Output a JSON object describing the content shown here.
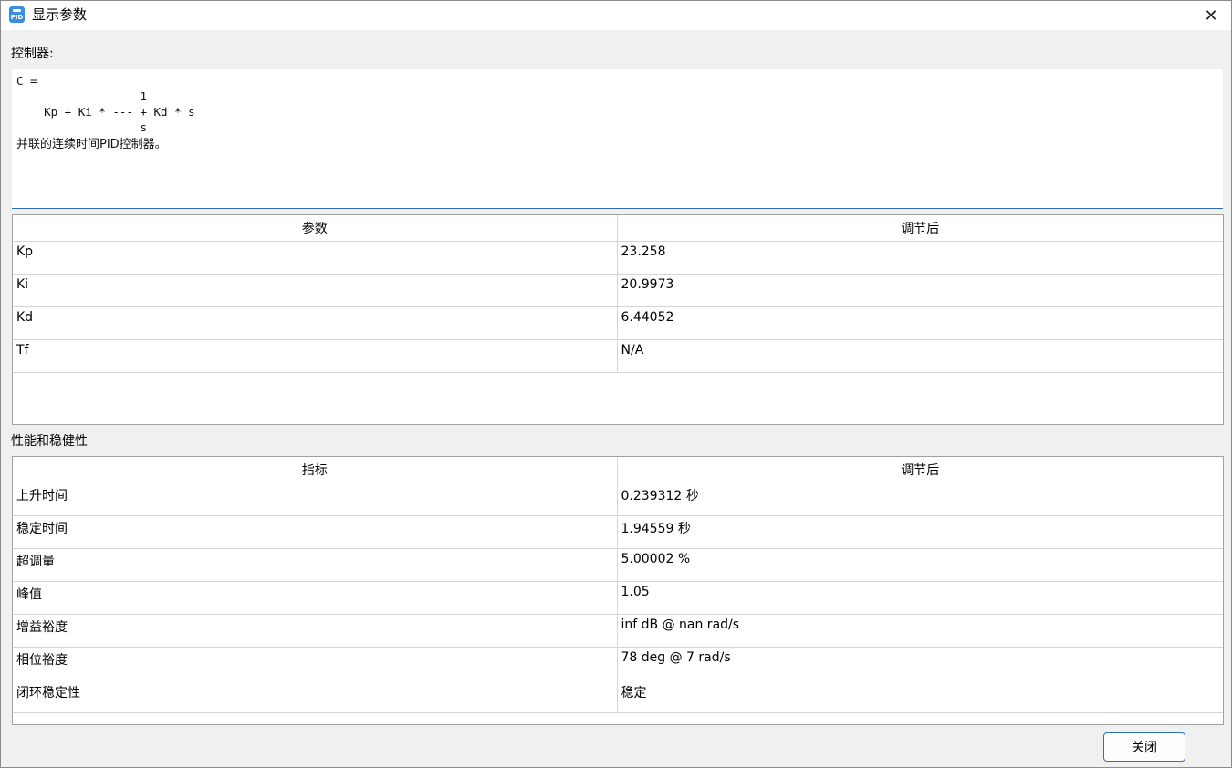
{
  "window": {
    "title": "显示参数"
  },
  "controller_label": "控制器:",
  "controller_formula": "C = \n                  1\n    Kp + Ki * --- + Kd * s\n                  s",
  "controller_desc": "并联的连续时间PID控制器。",
  "params_table": {
    "headers": [
      "参数",
      "调节后"
    ],
    "rows": [
      [
        "Kp",
        "23.258"
      ],
      [
        "Ki",
        "20.9973"
      ],
      [
        "Kd",
        "6.44052"
      ],
      [
        "Tf",
        "N/A"
      ]
    ]
  },
  "perf_label": "性能和稳健性",
  "perf_table": {
    "headers": [
      "指标",
      "调节后"
    ],
    "rows": [
      [
        "上升时间",
        "0.239312 秒"
      ],
      [
        "稳定时间",
        "1.94559 秒"
      ],
      [
        "超调量",
        "5.00002 %"
      ],
      [
        "峰值",
        "1.05"
      ],
      [
        "增益裕度",
        "inf dB @ nan rad/s"
      ],
      [
        "相位裕度",
        "78 deg @ 7 rad/s"
      ],
      [
        "闭环稳定性",
        "稳定"
      ]
    ]
  },
  "close_button": "关闭",
  "icons": {
    "app": "PID",
    "close": "✕"
  }
}
